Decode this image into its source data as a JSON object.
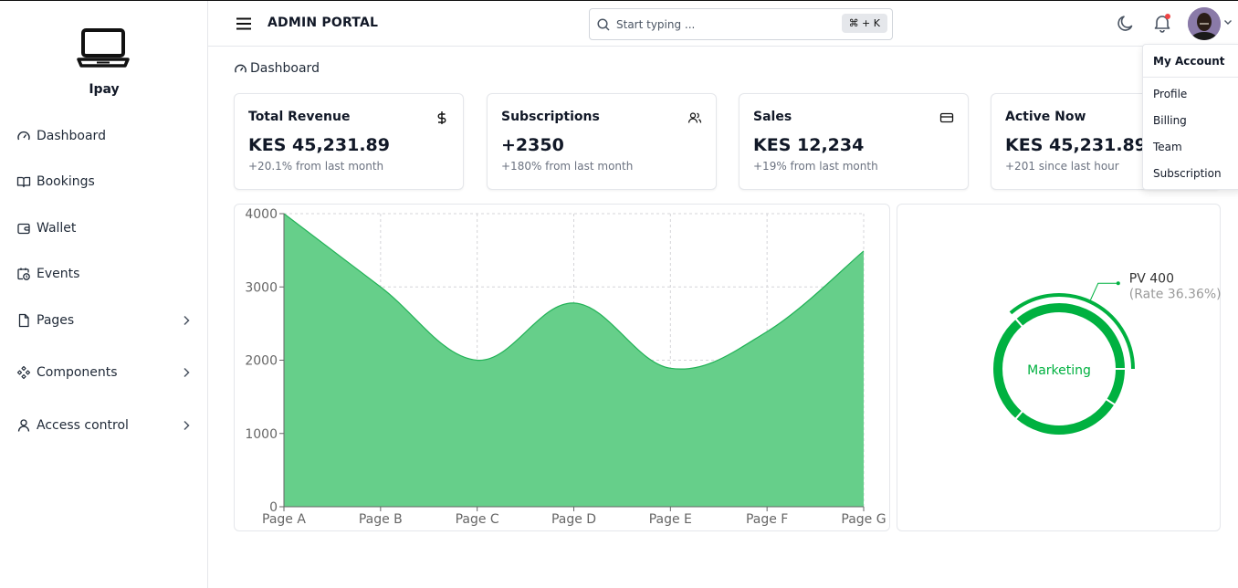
{
  "app": {
    "brand": "Ipay",
    "portal_title": "ADMIN PORTAL"
  },
  "sidebar": {
    "items": [
      {
        "label": "Dashboard",
        "icon": "gauge-icon",
        "has_chevron": false
      },
      {
        "label": "Bookings",
        "icon": "book-open-icon",
        "has_chevron": false
      },
      {
        "label": "Wallet",
        "icon": "wallet-icon",
        "has_chevron": false
      },
      {
        "label": "Events",
        "icon": "calendar-clock-icon",
        "has_chevron": false
      },
      {
        "label": "Pages",
        "icon": "file-icon",
        "has_chevron": true
      },
      {
        "label": "Components",
        "icon": "components-icon",
        "has_chevron": true
      },
      {
        "label": "Access control",
        "icon": "user-icon",
        "has_chevron": true
      }
    ]
  },
  "header": {
    "search_placeholder": "Start typing ...",
    "shortcut": "⌘ + K",
    "notifications_unread": true
  },
  "dropdown": {
    "header": "My Account",
    "items": [
      "Profile",
      "Billing",
      "Team",
      "Subscription"
    ]
  },
  "breadcrumb": {
    "label": "Dashboard"
  },
  "cards": [
    {
      "title": "Total Revenue",
      "icon": "dollar-icon",
      "value": "KES 45,231.89",
      "sub": "+20.1% from last month"
    },
    {
      "title": "Subscriptions",
      "icon": "users-icon",
      "value": "+2350",
      "sub": "+180% from last month"
    },
    {
      "title": "Sales",
      "icon": "credit-card-icon",
      "value": "KES 12,234",
      "sub": "+19% from last month"
    },
    {
      "title": "Active Now",
      "icon": "activity-icon",
      "value": "KES 45,231.89",
      "sub": "+201 since last hour"
    }
  ],
  "colors": {
    "accent": "#00b140",
    "area_fill": "#66cf8a",
    "area_stroke": "#22b257"
  },
  "chart_data": [
    {
      "type": "area",
      "categories": [
        "Page A",
        "Page B",
        "Page C",
        "Page D",
        "Page E",
        "Page F",
        "Page G"
      ],
      "series": [
        {
          "values": [
            4000,
            3000,
            2000,
            2780,
            1890,
            2390,
            3490
          ]
        }
      ],
      "ylim": [
        0,
        4000
      ],
      "yticks": [
        0,
        1000,
        2000,
        3000,
        4000
      ],
      "grid": true
    },
    {
      "type": "pie",
      "center_label": "Marketing",
      "active_label": "PV 400",
      "active_rate": "(Rate 36.36%)",
      "slices": [
        {
          "value": 400,
          "rate": 36.36
        },
        {
          "value": 300
        },
        {
          "value": 300
        },
        {
          "value": 100
        }
      ]
    }
  ]
}
